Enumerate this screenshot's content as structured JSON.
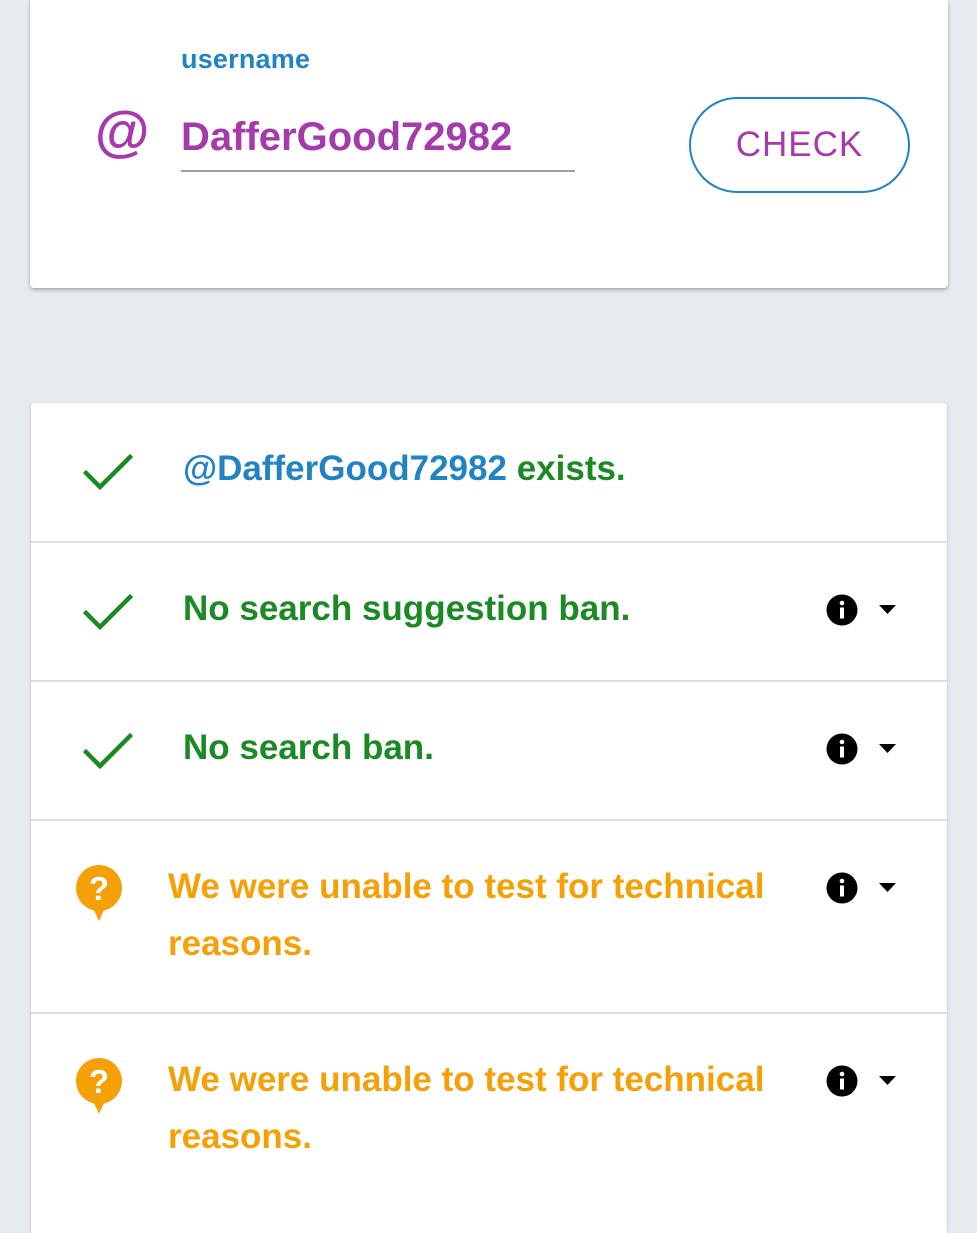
{
  "search": {
    "label": "username",
    "at_symbol": "@",
    "value": "DafferGood72982",
    "button_label": "CHECK"
  },
  "results": [
    {
      "status": "success",
      "icon": "check-icon",
      "username": "@DafferGood72982",
      "text": " exists."
    },
    {
      "status": "success",
      "icon": "check-icon",
      "text": "No search suggestion ban."
    },
    {
      "status": "success",
      "icon": "check-icon",
      "text": "No search ban."
    },
    {
      "status": "unknown",
      "icon": "question-icon",
      "text": "We were unable to test for technical reasons."
    },
    {
      "status": "unknown",
      "icon": "question-icon",
      "text": "We were unable to test for technical reasons."
    }
  ],
  "colors": {
    "accent_blue": "#1f83c4",
    "accent_purple": "#a63aad",
    "success_green": "#1b8a24",
    "warning_orange": "#f5a007",
    "page_background": "#e6ebef"
  }
}
